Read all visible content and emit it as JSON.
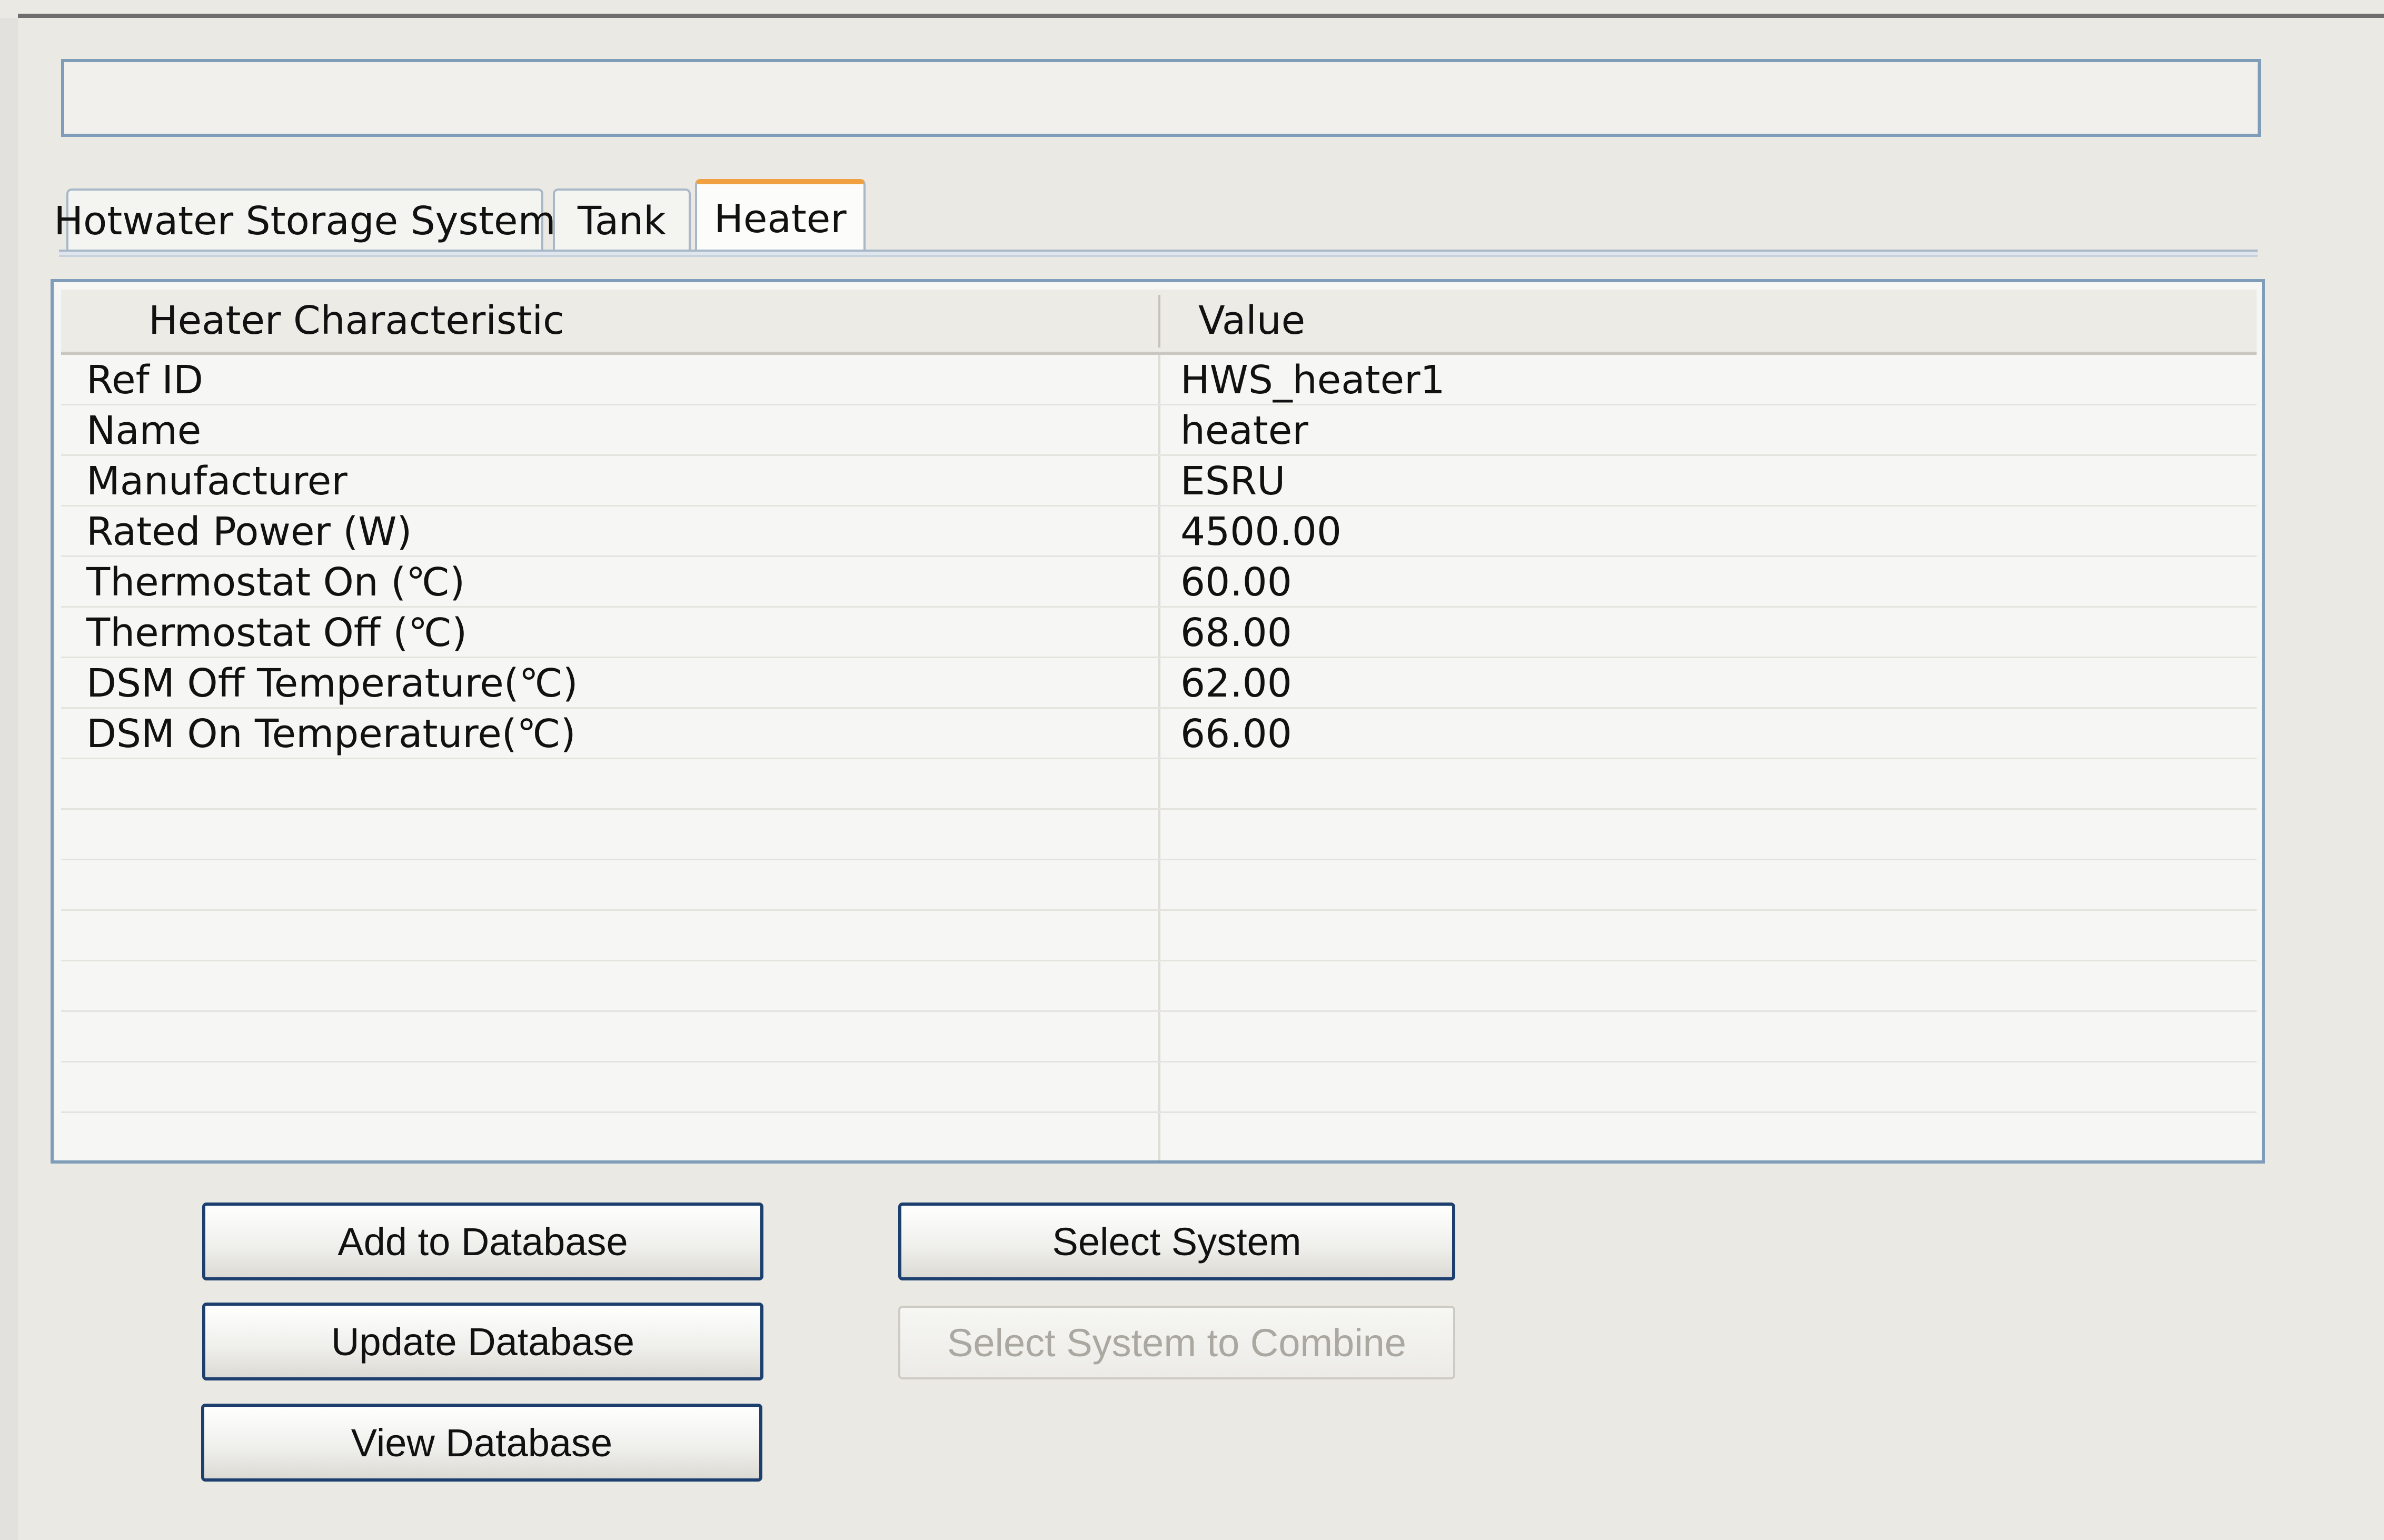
{
  "tabs": [
    {
      "label": "Hotwater Storage System",
      "active": false
    },
    {
      "label": "Tank",
      "active": false
    },
    {
      "label": "Heater",
      "active": true
    }
  ],
  "table": {
    "headers": [
      "Heater Characteristic",
      "Value"
    ],
    "rows": [
      {
        "characteristic": "Ref ID",
        "value": "HWS_heater1"
      },
      {
        "characteristic": "Name",
        "value": "heater"
      },
      {
        "characteristic": "Manufacturer",
        "value": "ESRU"
      },
      {
        "characteristic": "Rated Power (W)",
        "value": "4500.00"
      },
      {
        "characteristic": "Thermostat On (℃)",
        "value": "60.00"
      },
      {
        "characteristic": "Thermostat Off (℃)",
        "value": "68.00"
      },
      {
        "characteristic": "DSM Off Temperature(℃)",
        "value": "62.00"
      },
      {
        "characteristic": "DSM On Temperature(℃)",
        "value": "66.00"
      }
    ],
    "empty_rows": 8
  },
  "buttons": {
    "add_to_database": "Add to Database",
    "update_database": "Update Database",
    "view_database": "View Database",
    "select_system": "Select System",
    "select_system_to_combine": "Select System to Combine"
  },
  "colors": {
    "active_tab_accent": "#f0a040",
    "field_border": "#7f9db9",
    "button_border": "#1d3f6e"
  }
}
